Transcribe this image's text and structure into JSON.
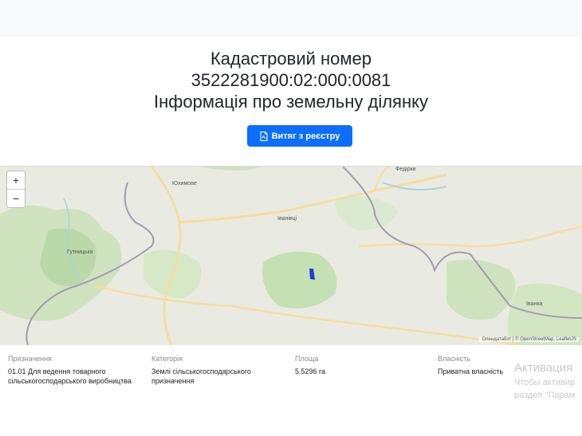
{
  "header": {
    "line1": "Кадастровий номер",
    "line2": "3522281900:02:000:0081",
    "line3": "Інформація про земельну ділянку"
  },
  "extract_button": {
    "label": "Витяг з реєстру",
    "icon": "file-pdf-icon"
  },
  "map": {
    "zoom_in": "+",
    "zoom_out": "−",
    "places": {
      "fedorky": "Федірки",
      "yukymove": "Юхимове",
      "ivanivtsi": "Іванівці",
      "hutnytska": "Гутницька",
      "ivanka": "Іванка"
    },
    "attribution": "Олендатабот | © OpenStreetMap, LeafletJS",
    "parcel_color": "#1f3fd6"
  },
  "info": {
    "purpose": {
      "label": "Призначення",
      "value": "01.01 Для ведення товарного сільськогосподарського виробництва"
    },
    "category": {
      "label": "Категорія",
      "value": "Землі сільськогосподарського призначення"
    },
    "area": {
      "label": "Площа",
      "value": "5.5296 га"
    },
    "ownership": {
      "label": "Власність",
      "value": "Приватна власність"
    }
  },
  "watermark": {
    "title": "Активация",
    "line1": "Чтобы активир",
    "line2": "раздел \"Парам"
  },
  "colors": {
    "primary": "#0d6efd",
    "label_gray": "#8a8a8a"
  }
}
